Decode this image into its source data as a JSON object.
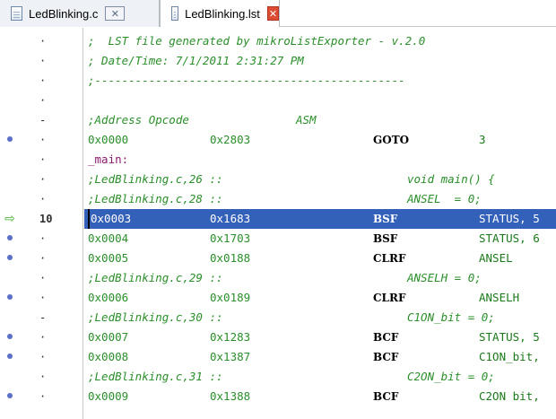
{
  "tabs": [
    {
      "label": "LedBlinking.c",
      "active": false,
      "close_glyph": "✕"
    },
    {
      "label": "LedBlinking.lst",
      "active": true,
      "close_glyph": "✕"
    }
  ],
  "lines": [
    {
      "kind": "comment",
      "marker": "·",
      "bp": "",
      "text": ";  LST file generated by mikroListExporter - v.2.0"
    },
    {
      "kind": "comment",
      "marker": "·",
      "bp": "",
      "text": "; Date/Time: 7/1/2011 2:31:27 PM"
    },
    {
      "kind": "comment",
      "marker": "·",
      "bp": "",
      "text": ";----------------------------------------------"
    },
    {
      "kind": "blank",
      "marker": "·",
      "bp": "",
      "text": ""
    },
    {
      "kind": "header",
      "marker": "-",
      "bp": "",
      "cols": [
        ";Address Opcode",
        "ASM"
      ]
    },
    {
      "kind": "instr",
      "marker": "·",
      "bp": "dot",
      "addr": "0x0000",
      "opcode": "0x2803",
      "mnemonic": "GOTO",
      "operand": "3"
    },
    {
      "kind": "label",
      "marker": "·",
      "bp": "",
      "text": "_main:"
    },
    {
      "kind": "src",
      "marker": "·",
      "bp": "",
      "ref": ";LedBlinking.c,26 ::",
      "src": "void main() {"
    },
    {
      "kind": "src",
      "marker": "·",
      "bp": "",
      "ref": ";LedBlinking.c,28 ::",
      "src": "ANSEL  = 0;"
    },
    {
      "kind": "instr",
      "marker": "10",
      "bp": "arrow",
      "current": true,
      "addr": "0x0003",
      "opcode": "0x1683",
      "mnemonic": "BSF",
      "operand": "STATUS, 5"
    },
    {
      "kind": "instr",
      "marker": "·",
      "bp": "dot",
      "addr": "0x0004",
      "opcode": "0x1703",
      "mnemonic": "BSF",
      "operand": "STATUS, 6"
    },
    {
      "kind": "instr",
      "marker": "·",
      "bp": "dot",
      "addr": "0x0005",
      "opcode": "0x0188",
      "mnemonic": "CLRF",
      "operand": "ANSEL"
    },
    {
      "kind": "src",
      "marker": "·",
      "bp": "",
      "ref": ";LedBlinking.c,29 ::",
      "src": "ANSELH = 0;"
    },
    {
      "kind": "instr",
      "marker": "·",
      "bp": "dot",
      "addr": "0x0006",
      "opcode": "0x0189",
      "mnemonic": "CLRF",
      "operand": "ANSELH"
    },
    {
      "kind": "src",
      "marker": "-",
      "bp": "",
      "ref": ";LedBlinking.c,30 ::",
      "src": "C1ON_bit = 0;"
    },
    {
      "kind": "instr",
      "marker": "·",
      "bp": "dot",
      "addr": "0x0007",
      "opcode": "0x1283",
      "mnemonic": "BCF",
      "operand": "STATUS, 5"
    },
    {
      "kind": "instr",
      "marker": "·",
      "bp": "dot",
      "addr": "0x0008",
      "opcode": "0x1387",
      "mnemonic": "BCF",
      "operand": "C1ON_bit,"
    },
    {
      "kind": "src",
      "marker": "·",
      "bp": "",
      "ref": ";LedBlinking.c,31 ::",
      "src": "C2ON_bit = 0;"
    },
    {
      "kind": "instr",
      "marker": "·",
      "bp": "dot",
      "addr": "0x0009",
      "opcode": "0x1388",
      "mnemonic": "BCF",
      "operand": "C2ON bit,"
    }
  ],
  "colors": {
    "comment": "#2a8f2a",
    "label": "#8a1a6a",
    "highlight": "#3360b8",
    "breakpoint": "#5b6ec8",
    "pc_arrow": "#3fae2a"
  }
}
